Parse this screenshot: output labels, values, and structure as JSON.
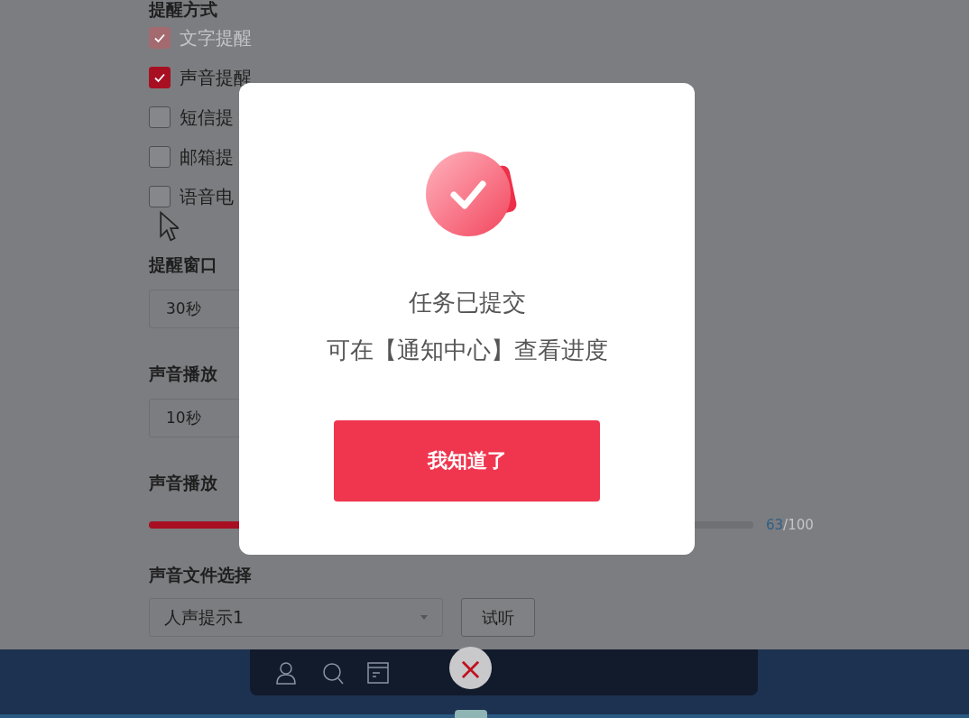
{
  "form": {
    "heading": "提醒方式",
    "options": [
      {
        "label": "文字提醒",
        "checked": true,
        "disabled": true
      },
      {
        "label": "声音提醒",
        "checked": true,
        "disabled": false
      },
      {
        "label": "短信提",
        "checked": false,
        "disabled": false
      },
      {
        "label": "邮箱提",
        "checked": false,
        "disabled": false
      },
      {
        "label": "语音电",
        "checked": false,
        "disabled": false
      }
    ],
    "window_duration": {
      "title": "提醒窗口",
      "value": "30秒"
    },
    "sound_duration": {
      "title": "声音播放",
      "value": "10秒"
    },
    "volume": {
      "title": "声音播放",
      "level": 0.63,
      "reading_value": "63",
      "reading_total": "/100"
    },
    "sound_file": {
      "title": "声音文件选择",
      "value": "人声提示1",
      "button": "试听"
    }
  },
  "dialog": {
    "title": "任务已提交",
    "message": "可在【通知中心】查看进度",
    "button": "我知道了"
  },
  "taskbar": {
    "close": "×"
  }
}
